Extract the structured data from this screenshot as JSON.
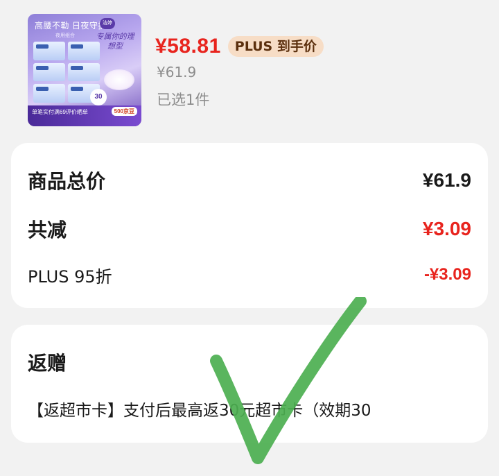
{
  "product": {
    "thumbnail": {
      "headline": "高腰不勒 日夜守护",
      "sub": "夜用组合",
      "brand": "洁婷",
      "slogan": "专属你的理想型",
      "badge_count": "30",
      "footer_text": "单笔实付满69评价晒单",
      "bean_badge": "500京豆",
      "pack_label": "透气U感"
    },
    "price_current": "¥58.81",
    "plus_badge": "PLUS 到手价",
    "price_original": "¥61.9",
    "selected_count": "已选1件"
  },
  "summary": {
    "total_label": "商品总价",
    "total_value": "¥61.9",
    "reduce_label": "共减",
    "reduce_value": "¥3.09",
    "plus_discount_label": "PLUS 95折",
    "plus_discount_value": "-¥3.09"
  },
  "gift": {
    "title": "返赠",
    "description": "【返超市卡】支付后最高返30元超市卡（效期30"
  },
  "colors": {
    "price_red": "#e8241e",
    "plus_badge_bg": "#f7ddc6",
    "checkmark_green": "#4caf50"
  }
}
